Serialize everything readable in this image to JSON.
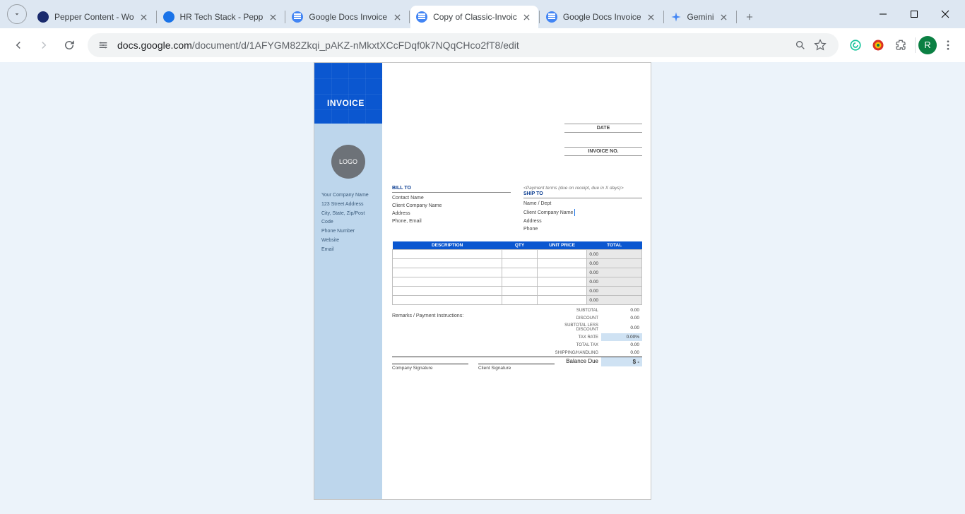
{
  "tabs": [
    {
      "title": "Pepper Content - Wo"
    },
    {
      "title": "HR Tech Stack - Pepp"
    },
    {
      "title": "Google Docs Invoice"
    },
    {
      "title": "Copy of Classic-Invoic"
    },
    {
      "title": "Google Docs Invoice"
    },
    {
      "title": "Gemini"
    }
  ],
  "url": {
    "host": "docs.google.com",
    "path": "/document/d/1AFYGM82Zkqi_pAKZ-nMkxtXCcFDqf0k7NQqCHco2fT8/edit"
  },
  "avatar": "R",
  "invoice": {
    "heading": "INVOICE",
    "logo": "LOGO",
    "company": {
      "name": "Your Company Name",
      "addr": "123 Street Address",
      "csz": "City, State, Zip/Post Code",
      "phone": "Phone Number",
      "web": "Website",
      "email": "Email"
    },
    "date_label": "DATE",
    "invno_label": "INVOICE NO.",
    "payment_terms": "<Payment terms (due on receipt, due in X days)>",
    "bill": {
      "heading": "BILL TO",
      "contact": "Contact Name",
      "company": "Client Company Name",
      "address": "Address",
      "phone_email": "Phone, Email"
    },
    "ship": {
      "heading": "SHIP TO",
      "name": "Name / Dept",
      "company": "Client Company Name",
      "address": "Address",
      "phone": "Phone"
    },
    "table": {
      "headers": {
        "desc": "DESCRIPTION",
        "qty": "QTY",
        "unit": "UNIT PRICE",
        "total": "TOTAL"
      },
      "rows": [
        {
          "total": "0.00"
        },
        {
          "total": "0.00"
        },
        {
          "total": "0.00"
        },
        {
          "total": "0.00"
        },
        {
          "total": "0.00"
        },
        {
          "total": "0.00"
        }
      ]
    },
    "totals": {
      "subtotal": {
        "label": "SUBTOTAL",
        "value": "0.00"
      },
      "discount": {
        "label": "DISCOUNT",
        "value": "0.00"
      },
      "subless": {
        "label": "SUBTOTAL LESS DISCOUNT",
        "value": "0.00"
      },
      "taxrate": {
        "label": "TAX RATE",
        "value": "0.00%"
      },
      "totaltax": {
        "label": "TOTAL TAX",
        "value": "0.00"
      },
      "shipping": {
        "label": "SHIPPING/HANDLING",
        "value": "0.00"
      },
      "balance": {
        "label": "Balance Due",
        "value": "$ -"
      }
    },
    "remarks": "Remarks / Payment Instructions:",
    "sig_company": "Company Signature",
    "sig_client": "Client Signature"
  }
}
